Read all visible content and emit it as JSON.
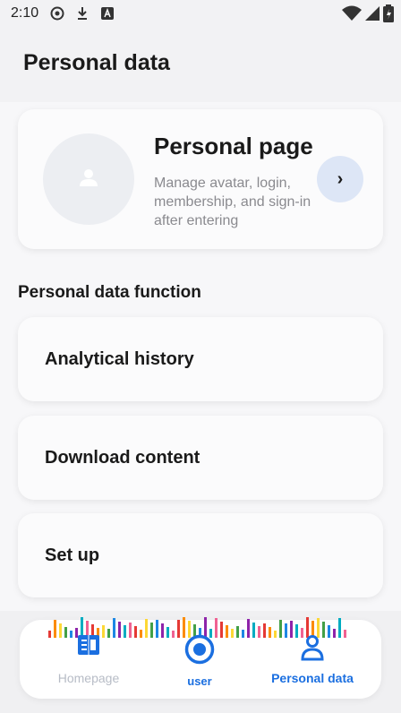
{
  "status_bar": {
    "time": "2:10",
    "icons": [
      "circle-dot-icon",
      "download-icon",
      "a-box-icon"
    ],
    "right_icons": [
      "wifi-icon",
      "signal-icon",
      "battery-icon"
    ]
  },
  "header": {
    "title": "Personal data"
  },
  "profile_card": {
    "title": "Personal page",
    "description": "Manage avatar, login, membership, and sign-in after entering",
    "arrow": "›"
  },
  "section": {
    "title": "Personal data function"
  },
  "functions": [
    {
      "label": "Analytical history"
    },
    {
      "label": "Download content"
    },
    {
      "label": "Set up"
    }
  ],
  "nav": {
    "items": [
      {
        "label": "Homepage",
        "icon": "book-icon",
        "active": false
      },
      {
        "label": "user",
        "icon": "record-icon",
        "active": true
      },
      {
        "label": "Personal data",
        "icon": "person-icon",
        "active": true
      }
    ]
  },
  "colors": {
    "accent": "#1b6fe0",
    "inactive": "#b7bcc6",
    "arrow_bg": "#dde6f6"
  }
}
